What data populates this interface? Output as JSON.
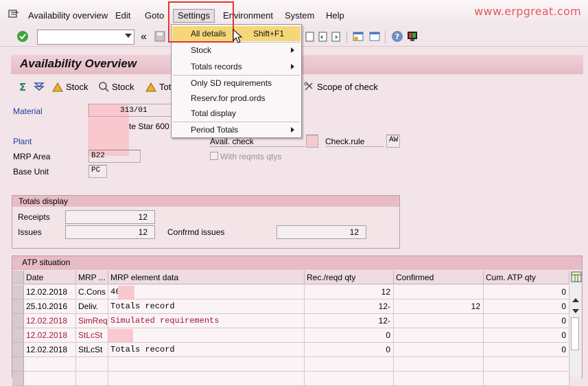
{
  "watermark": "www.erpgreat.com",
  "menubar": {
    "items": [
      "Availability overview",
      "Edit",
      "Goto",
      "Settings",
      "Environment",
      "System",
      "Help"
    ]
  },
  "settings_menu": {
    "items": [
      {
        "label": "All details",
        "shortcut": "Shift+F1",
        "highlighted": true
      },
      {
        "label": "Stock",
        "submenu": true
      },
      {
        "label": "Totals records",
        "submenu": true
      },
      {
        "label": "Only SD requirements"
      },
      {
        "label": "Reserv.for prod.ords"
      },
      {
        "label": "Total display"
      },
      {
        "label": "Period Totals",
        "submenu": true
      }
    ]
  },
  "page_title": "Availability Overview",
  "app_toolbar": {
    "stock1": "Stock",
    "stock2": "Stock",
    "tot": "Tot",
    "scope": "Scope of check"
  },
  "header": {
    "material_label": "Material",
    "material_value": "313/01",
    "description_fragment": "te Star 600",
    "plant_label": "Plant",
    "mrp_area_label": "MRP Area",
    "mrp_area_value": "B22",
    "base_unit_label": "Base Unit",
    "base_unit_value": "PC",
    "avail_check_label": "Avail. check",
    "check_rule_label": "Check.rule",
    "check_rule_value": "AW",
    "with_reqmts_label": "With reqmts qtys"
  },
  "totals": {
    "title": "Totals display",
    "receipts_label": "Receipts",
    "receipts_value": "12",
    "issues_label": "Issues",
    "issues_value": "12",
    "confrmd_label": "Confrmd issues",
    "confrmd_value": "12"
  },
  "atp": {
    "title": "ATP situation",
    "columns": [
      "Date",
      "MRP ...",
      "MRP element data",
      "Rec./reqd qty",
      "Confirmed",
      "Cum. ATP qty"
    ],
    "rows": [
      {
        "date": "12.02.2018",
        "mrp": "C.Cons",
        "element": "466",
        "rec": "12",
        "confirmed": "",
        "cum": "0",
        "red": false
      },
      {
        "date": "25.10.2016",
        "mrp": "Deliv.",
        "element": "Totals record",
        "rec": "12-",
        "confirmed": "12",
        "cum": "0",
        "red": false
      },
      {
        "date": "12.02.2018",
        "mrp": "SimReq",
        "element": "Simulated requirements",
        "rec": "12-",
        "confirmed": "",
        "cum": "0",
        "red": true
      },
      {
        "date": "12.02.2018",
        "mrp": "StLcSt",
        "element": "",
        "rec": "0",
        "confirmed": "",
        "cum": "0",
        "red": true
      },
      {
        "date": "12.02.2018",
        "mrp": "StLcSt",
        "element": "Totals record",
        "rec": "0",
        "confirmed": "",
        "cum": "0",
        "red": false
      }
    ]
  }
}
